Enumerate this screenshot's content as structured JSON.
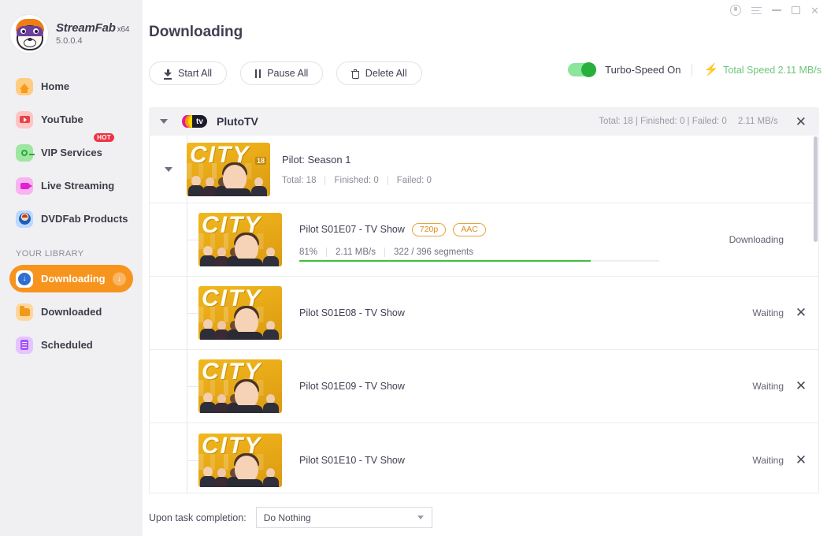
{
  "brand": {
    "name": "StreamFab",
    "arch": "x64",
    "version": "5.0.0.4",
    "logo_icon": "sloth-mascot-icon"
  },
  "sidebar": {
    "items": [
      {
        "label": "Home",
        "icon": "home-icon"
      },
      {
        "label": "YouTube",
        "icon": "youtube-icon"
      },
      {
        "label": "VIP Services",
        "icon": "key-icon",
        "badge": "HOT"
      },
      {
        "label": "Live Streaming",
        "icon": "video-camera-icon"
      },
      {
        "label": "DVDFab Products",
        "icon": "dvdfab-icon"
      }
    ],
    "library_title": "YOUR LIBRARY",
    "library_items": [
      {
        "label": "Downloading",
        "icon": "download-arrow-icon",
        "active": true,
        "trailing_icon": "download-arrow-icon"
      },
      {
        "label": "Downloaded",
        "icon": "folder-icon",
        "active": false
      },
      {
        "label": "Scheduled",
        "icon": "list-icon",
        "active": false
      }
    ]
  },
  "window_controls": {
    "theme": "moon-icon",
    "menu": "hamburger-menu-icon",
    "minimize": "minimize-icon",
    "maximize": "maximize-icon",
    "close": "close-icon",
    "close_glyph": "✕"
  },
  "header": {
    "title": "Downloading"
  },
  "toolbar": {
    "start_all": "Start All",
    "pause_all": "Pause All",
    "delete_all": "Delete All",
    "turbo_label": "Turbo-Speed On",
    "turbo_on": true,
    "total_speed": "Total Speed 2.11 MB/s",
    "bolt_icon": "lightning-bolt-icon",
    "accent_green": "#33c04c",
    "accent_orange": "#f7941e"
  },
  "group": {
    "name": "PlutoTV",
    "logo_icon": "plutotv-logo-icon",
    "stats_total": "Total: 18",
    "stats_finished": "Finished: 0",
    "stats_failed": "Failed: 0",
    "stats_text": "Total: 18 | Finished: 0 | Failed: 0",
    "speed": "2.11 MB/s",
    "close_glyph": "✕"
  },
  "season": {
    "title": "Pilot: Season 1",
    "total": "Total: 18",
    "finished": "Finished: 0",
    "failed": "Failed: 0",
    "poster_text": "CITY",
    "poster_rating": "18"
  },
  "episodes": [
    {
      "title": "Pilot S01E07 - TV Show",
      "quality": "720p",
      "audio": "AAC",
      "percent": "81%",
      "percent_value": 81,
      "speed": "2.11 MB/s",
      "segments": "322 / 396 segments",
      "status": "Downloading",
      "has_close": false,
      "poster_text": "CITY"
    },
    {
      "title": "Pilot S01E08 - TV Show",
      "status": "Waiting",
      "has_close": true,
      "poster_text": "CITY"
    },
    {
      "title": "Pilot S01E09 - TV Show",
      "status": "Waiting",
      "has_close": true,
      "poster_text": "CITY"
    },
    {
      "title": "Pilot S01E10 - TV Show",
      "status": "Waiting",
      "has_close": true,
      "poster_text": "CITY"
    }
  ],
  "footer": {
    "label": "Upon task completion:",
    "selected": "Do Nothing"
  }
}
